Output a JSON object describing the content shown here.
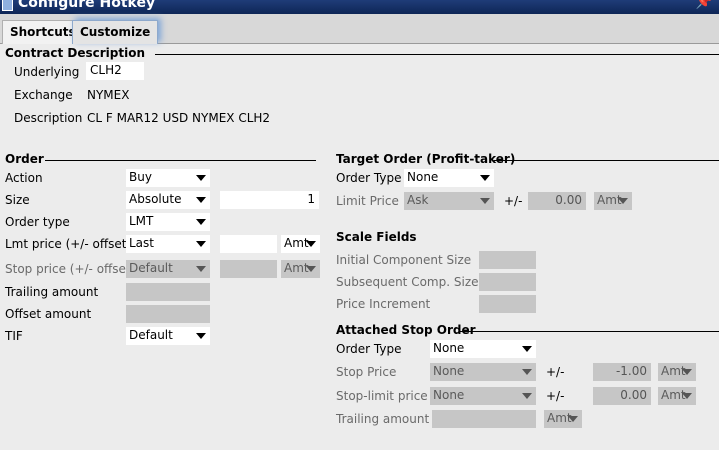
{
  "window": {
    "title": "Configure Hotkey"
  },
  "tabs": [
    {
      "label": "Shortcuts"
    },
    {
      "label": "Customize"
    }
  ],
  "contract": {
    "header": "Contract Description",
    "underlying_label": "Underlying",
    "underlying_value": "CLH2",
    "exchange_label": "Exchange",
    "exchange_value": "NYMEX",
    "description_label": "Description",
    "description_value": "CL F MAR12 USD NYMEX CLH2"
  },
  "order": {
    "header": "Order",
    "action_label": "Action",
    "action_value": "Buy",
    "size_label": "Size",
    "size_mode": "Absolute",
    "size_value": "1",
    "type_label": "Order type",
    "type_value": "LMT",
    "lmt_label": "Lmt price (+/- offset)",
    "lmt_source": "Last",
    "lmt_offset": "",
    "lmt_unit": "Amt",
    "stop_label": "Stop price (+/- offset)",
    "stop_source": "Default",
    "stop_offset": "",
    "stop_unit": "Amt",
    "trailing_label": "Trailing amount",
    "trailing_value": "",
    "offset_label": "Offset amount",
    "offset_value": "",
    "tif_label": "TIF",
    "tif_value": "Default"
  },
  "target": {
    "header": "Target Order (Profit-taker)",
    "type_label": "Order Type",
    "type_value": "None",
    "limit_label": "Limit Price",
    "limit_source": "Ask",
    "pm": "+/-",
    "limit_offset": "0.00",
    "limit_unit": "Amt"
  },
  "scale": {
    "header": "Scale Fields",
    "initial_label": "Initial Component Size",
    "initial_value": "",
    "subsequent_label": "Subsequent Comp. Size",
    "subsequent_value": "",
    "increment_label": "Price Increment",
    "increment_value": ""
  },
  "stop_order": {
    "header": "Attached Stop Order",
    "type_label": "Order Type",
    "type_value": "None",
    "stop_label": "Stop Price",
    "stop_source": "None",
    "stop_pm": "+/-",
    "stop_offset": "-1.00",
    "stop_unit": "Amt",
    "stoplimit_label": "Stop-limit price",
    "stoplimit_source": "None",
    "stoplimit_pm": "+/-",
    "stoplimit_offset": "0.00",
    "stoplimit_unit": "Amt",
    "trailing_label": "Trailing amount",
    "trailing_value": "",
    "trailing_unit": "Amt"
  }
}
